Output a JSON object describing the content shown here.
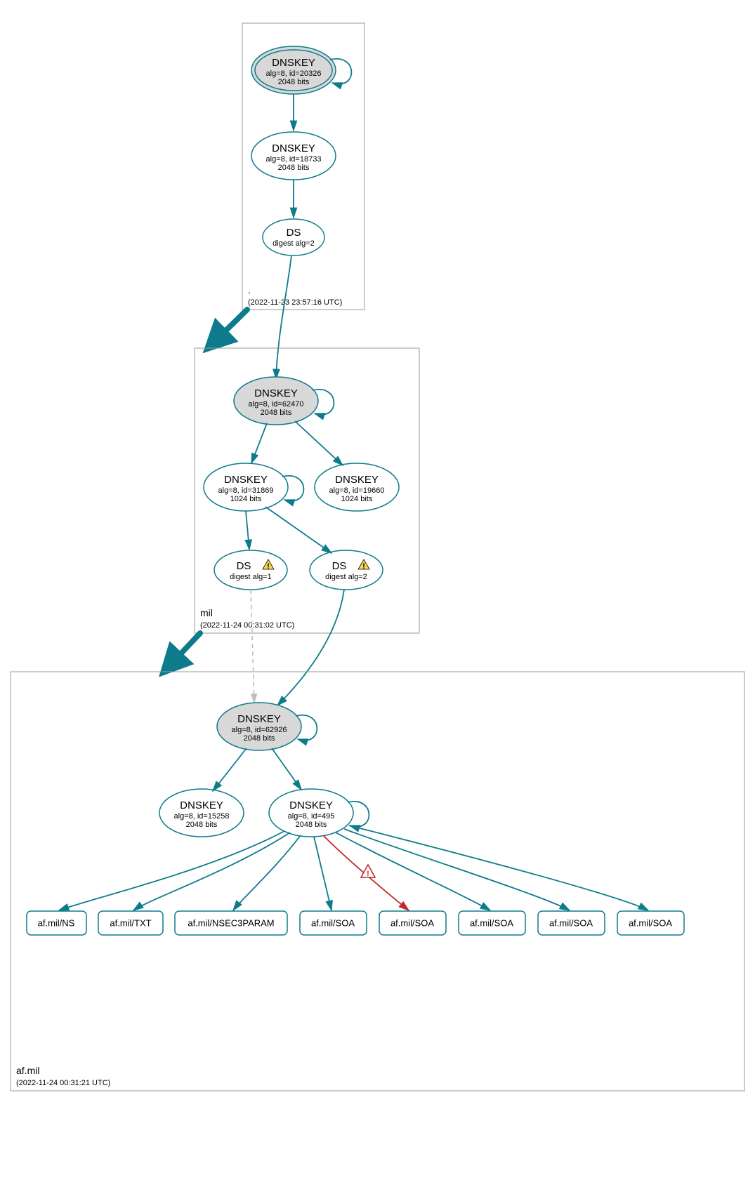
{
  "zones": {
    "root": {
      "label": ".",
      "timestamp": "(2022-11-23 23:57:16 UTC)"
    },
    "mil": {
      "label": "mil",
      "timestamp": "(2022-11-24 00:31:02 UTC)"
    },
    "afmil": {
      "label": "af.mil",
      "timestamp": "(2022-11-24 00:31:21 UTC)"
    }
  },
  "nodes": {
    "root_ksk": {
      "title": "DNSKEY",
      "sub1": "alg=8, id=20326",
      "sub2": "2048 bits"
    },
    "root_zsk": {
      "title": "DNSKEY",
      "sub1": "alg=8, id=18733",
      "sub2": "2048 bits"
    },
    "root_ds": {
      "title": "DS",
      "sub1": "digest alg=2"
    },
    "mil_ksk": {
      "title": "DNSKEY",
      "sub1": "alg=8, id=62470",
      "sub2": "2048 bits"
    },
    "mil_zsk1": {
      "title": "DNSKEY",
      "sub1": "alg=8, id=31869",
      "sub2": "1024 bits"
    },
    "mil_zsk2": {
      "title": "DNSKEY",
      "sub1": "alg=8, id=19660",
      "sub2": "1024 bits"
    },
    "mil_ds1": {
      "title": "DS",
      "sub1": "digest alg=1"
    },
    "mil_ds2": {
      "title": "DS",
      "sub1": "digest alg=2"
    },
    "af_ksk": {
      "title": "DNSKEY",
      "sub1": "alg=8, id=62926",
      "sub2": "2048 bits"
    },
    "af_zskA": {
      "title": "DNSKEY",
      "sub1": "alg=8, id=15258",
      "sub2": "2048 bits"
    },
    "af_zskB": {
      "title": "DNSKEY",
      "sub1": "alg=8, id=495",
      "sub2": "2048 bits"
    },
    "rr_ns": {
      "label": "af.mil/NS"
    },
    "rr_txt": {
      "label": "af.mil/TXT"
    },
    "rr_n3p": {
      "label": "af.mil/NSEC3PARAM"
    },
    "rr_soa1": {
      "label": "af.mil/SOA"
    },
    "rr_soa2": {
      "label": "af.mil/SOA"
    },
    "rr_soa3": {
      "label": "af.mil/SOA"
    },
    "rr_soa4": {
      "label": "af.mil/SOA"
    },
    "rr_soa5": {
      "label": "af.mil/SOA"
    }
  }
}
